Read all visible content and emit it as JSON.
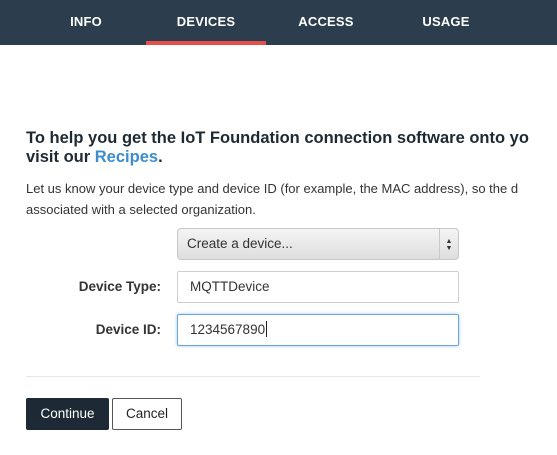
{
  "tabs": {
    "info": "INFO",
    "devices": "DEVICES",
    "access": "ACCESS",
    "usage": "USAGE",
    "active": "DEVICES"
  },
  "intro": {
    "headline_line1": "To help you get the IoT Foundation connection software onto yo",
    "headline_line2_prefix": "visit our ",
    "recipes_link": "Recipes",
    "headline_line2_suffix": ".",
    "desc_line1": "Let us know your device type and device ID (for example, the MAC address), so the d",
    "desc_line2": "associated with a selected organization."
  },
  "form": {
    "device_select_value": "Create a device...",
    "device_type_label": "Device Type:",
    "device_type_value": "MQTTDevice",
    "device_id_label": "Device ID:",
    "device_id_value": "1234567890"
  },
  "actions": {
    "continue_label": "Continue",
    "cancel_label": "Cancel"
  },
  "colors": {
    "tabbar_bg": "#2c3e4d",
    "active_tab_indicator": "#e5504a",
    "link": "#3b8dcc",
    "primary_button": "#1d2a36"
  },
  "icons": {
    "select_arrows": "up-down-arrows-icon"
  }
}
